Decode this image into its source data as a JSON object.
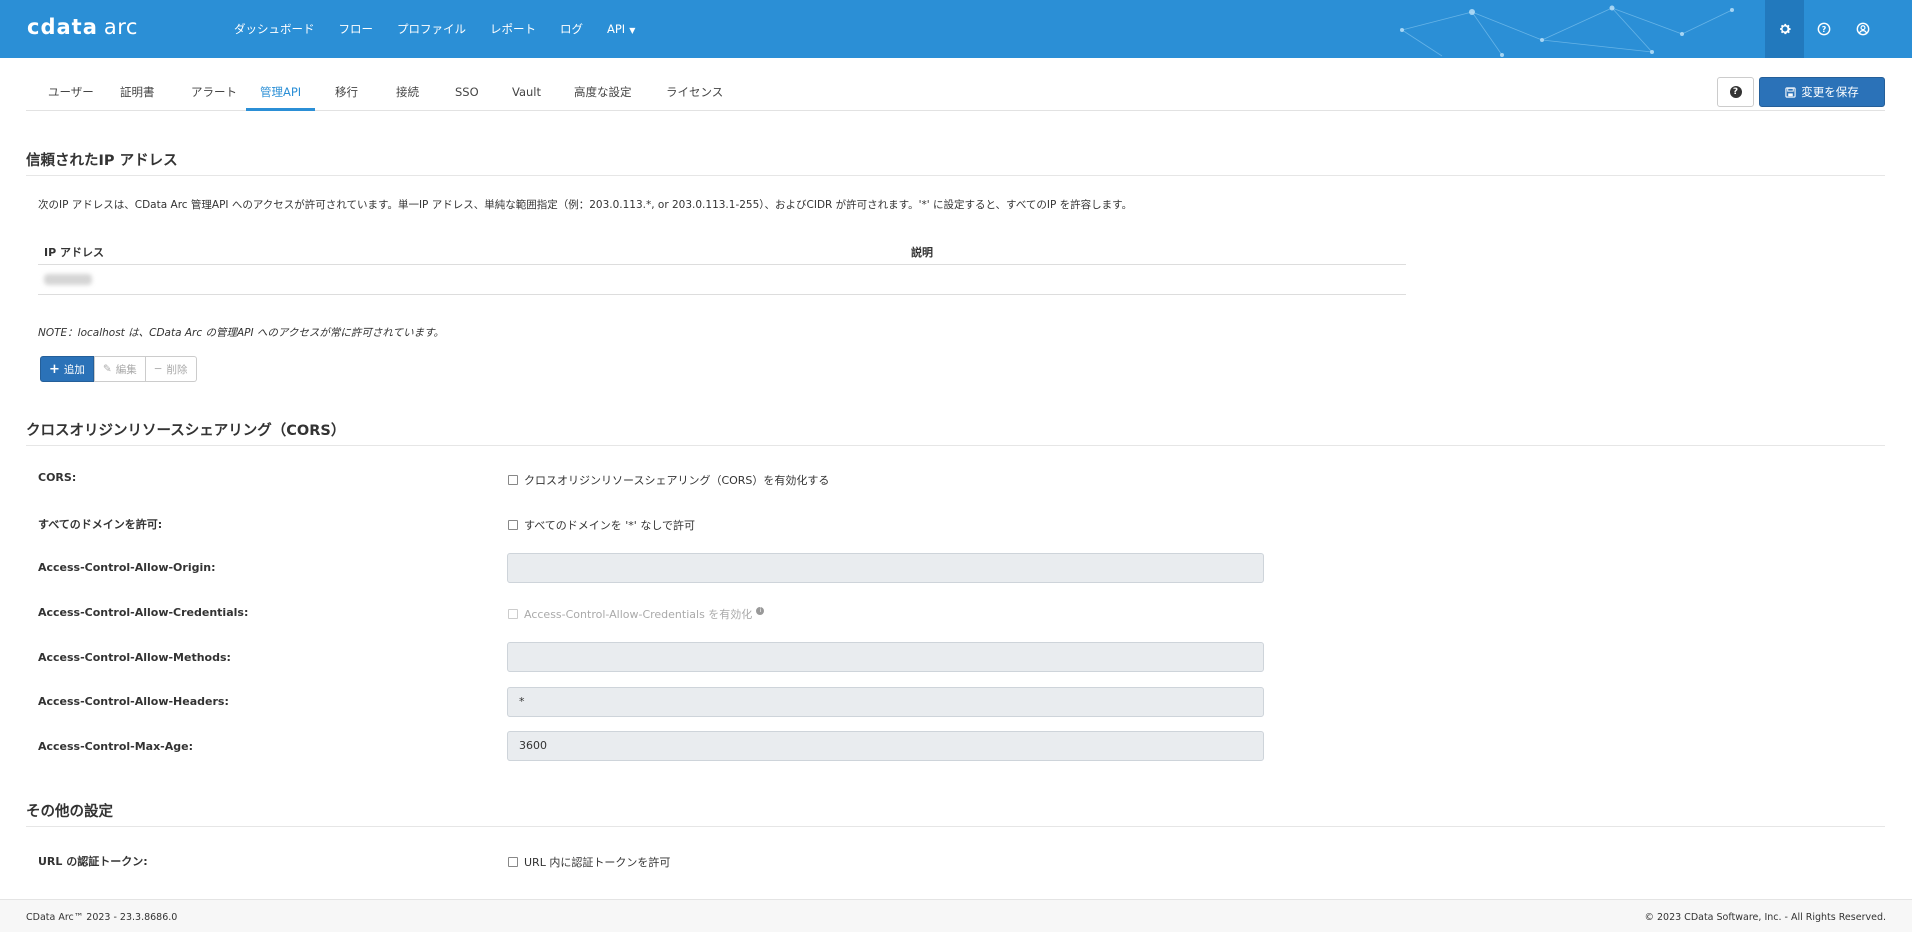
{
  "app": {
    "brand_main": "cdata",
    "brand_sub": "arc"
  },
  "nav": {
    "items": [
      "ダッシュボード",
      "フロー",
      "プロファイル",
      "レポート",
      "ログ",
      "API"
    ]
  },
  "top_icons": [
    "gear-icon",
    "question-circle-icon",
    "user-circle-icon"
  ],
  "tabs": [
    "ユーザー",
    "証明書",
    "アラート",
    "管理API",
    "移行",
    "接続",
    "SSO",
    "Vault",
    "高度な設定",
    "ライセンス"
  ],
  "active_tab": "管理API",
  "actions": {
    "save_label": "変更を保存",
    "help_label": "?"
  },
  "trusted_ip": {
    "title": "信頼されたIP アドレス",
    "description": "次のIP アドレスは、CData Arc 管理API へのアクセスが許可されています。単一IP アドレス、単純な範囲指定（例：203.0.113.*, or 203.0.113.1-255）、およびCIDR が許可されます。'*' に設定すると、すべてのIP を許容します。",
    "columns": [
      "IP アドレス",
      "説明"
    ],
    "note": "NOTE：localhost は、CData Arc の管理API へのアクセスが常に許可されています。",
    "buttons": {
      "add": "追加",
      "edit": "編集",
      "delete": "削除"
    }
  },
  "cors": {
    "title": "クロスオリジンリソースシェアリング（CORS）",
    "fields": {
      "cors_label": "CORS:",
      "cors_checkbox": "クロスオリジンリソースシェアリング（CORS）を有効化する",
      "all_domains_label": "すべてのドメインを許可:",
      "all_domains_checkbox": "すべてのドメインを '*' なしで許可",
      "origin_label": "Access-Control-Allow-Origin:",
      "origin_value": "",
      "credentials_label": "Access-Control-Allow-Credentials:",
      "credentials_checkbox": "Access-Control-Allow-Credentials を有効化",
      "methods_label": "Access-Control-Allow-Methods:",
      "methods_value": "",
      "headers_label": "Access-Control-Allow-Headers:",
      "headers_value": "*",
      "max_age_label": "Access-Control-Max-Age:",
      "max_age_value": "3600"
    }
  },
  "other": {
    "title": "その他の設定",
    "url_token_label": "URL の認証トークン:",
    "url_token_checkbox": "URL 内に認証トークンを許可"
  },
  "footer": {
    "left": "CData Arc™ 2023 - 23.3.8686.0",
    "right": "© 2023 CData Software, Inc. - All Rights Reserved."
  },
  "colors": {
    "header_bg": "#2b8fd6",
    "primary_button": "#2b72b8",
    "active_tab": "#2b8fd6"
  }
}
